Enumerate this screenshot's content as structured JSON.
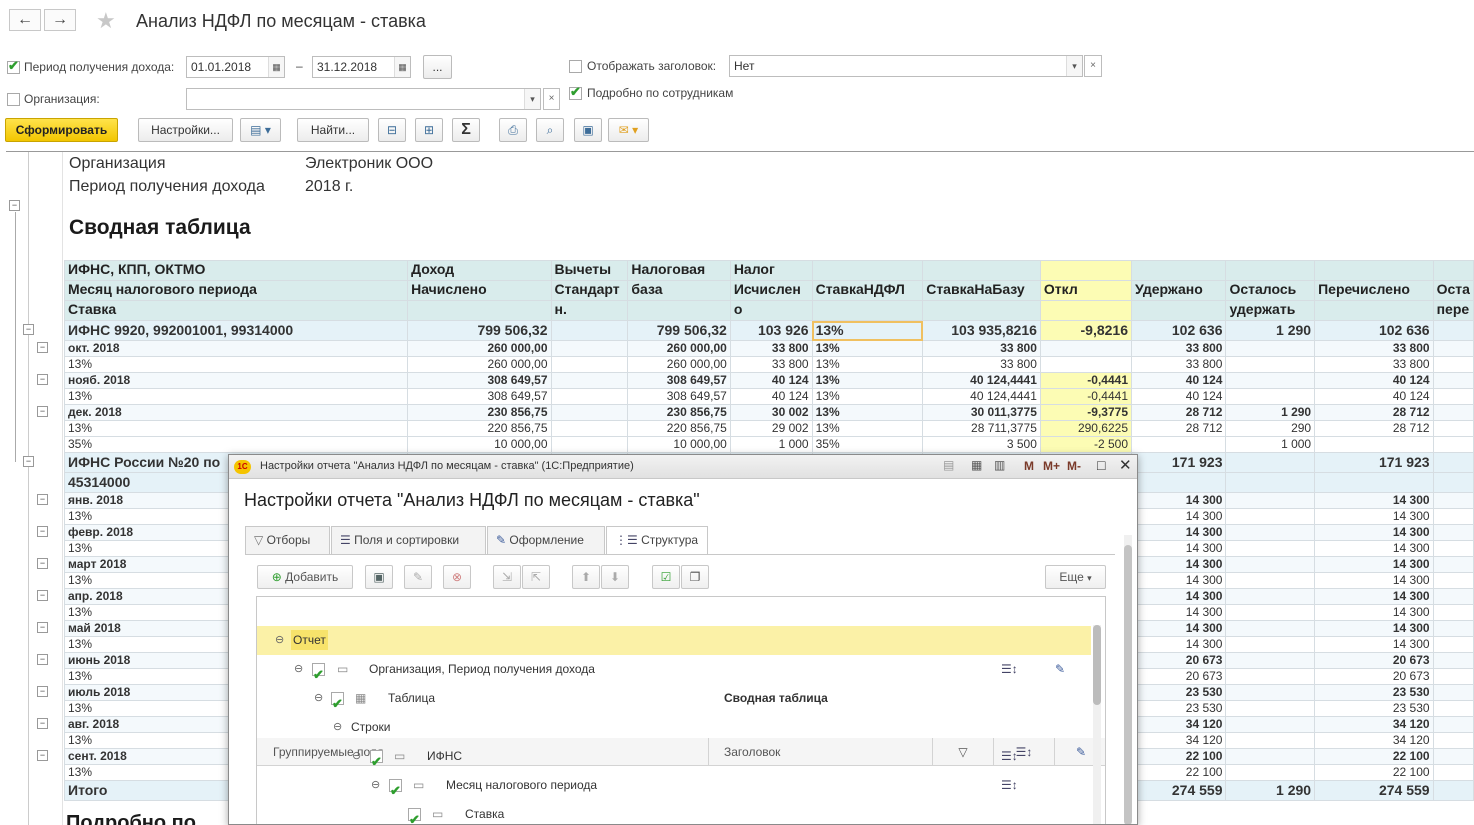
{
  "window": {
    "title": "Анализ НДФЛ по месяцам - ставка",
    "back": "←",
    "forward": "→",
    "star": "★"
  },
  "filters": {
    "period_label": "Период получения дохода:",
    "date_from": "01.01.2018",
    "dash": "–",
    "date_to": "31.12.2018",
    "dots": "...",
    "org_label": "Организация:",
    "org_value": "",
    "show_header_label": "Отображать заголовок:",
    "show_header_value": "Нет",
    "detail_label": "Подробно по сотрудникам"
  },
  "toolbar": {
    "generate": "Сформировать",
    "settings": "Настройки...",
    "find": "Найти...",
    "sum": "Σ"
  },
  "report": {
    "org_label": "Организация",
    "org_value": "Электроник ООО",
    "period_label": "Период получения дохода",
    "period_value": "2018 г.",
    "table_title": "Сводная таблица",
    "headers": [
      [
        "ИФНС, КПП, ОКТМО",
        "Доход",
        "Вычеты",
        "Налоговая",
        "Налог",
        "",
        "",
        "",
        "",
        "",
        "",
        ""
      ],
      [
        "Месяц налогового периода",
        "Начислено",
        "Стандарт",
        "база",
        "Исчислен",
        "СтавкаНДФЛ",
        "СтавкаНаБазу",
        "Откл",
        "Удержано",
        "Осталось",
        "Перечислено",
        "Оста"
      ],
      [
        "Ставка",
        "",
        "н.",
        "",
        "о",
        "",
        "",
        "",
        "",
        "удержать",
        "",
        "пере"
      ]
    ],
    "rows": [
      {
        "lvl": 1,
        "c": [
          "ИФНС 9920, 992001001, 99314000",
          "799 506,32",
          "",
          "799 506,32",
          "103 926",
          "13%",
          "103 935,8216",
          "-9,8216",
          "102 636",
          "1 290",
          "102 636",
          ""
        ]
      },
      {
        "lvl": 2,
        "c": [
          "окт. 2018",
          "260 000,00",
          "",
          "260 000,00",
          "33 800",
          "13%",
          "33 800",
          "",
          "33 800",
          "",
          "33 800",
          ""
        ]
      },
      {
        "lvl": 3,
        "c": [
          "13%",
          "260 000,00",
          "",
          "260 000,00",
          "33 800",
          "13%",
          "33 800",
          "",
          "33 800",
          "",
          "33 800",
          ""
        ]
      },
      {
        "lvl": 2,
        "c": [
          "нояб. 2018",
          "308 649,57",
          "",
          "308 649,57",
          "40 124",
          "13%",
          "40 124,4441",
          "-0,4441",
          "40 124",
          "",
          "40 124",
          ""
        ]
      },
      {
        "lvl": 3,
        "c": [
          "13%",
          "308 649,57",
          "",
          "308 649,57",
          "40 124",
          "13%",
          "40 124,4441",
          "-0,4441",
          "40 124",
          "",
          "40 124",
          ""
        ]
      },
      {
        "lvl": 2,
        "c": [
          "дек. 2018",
          "230 856,75",
          "",
          "230 856,75",
          "30 002",
          "13%",
          "30 011,3775",
          "-9,3775",
          "28 712",
          "1 290",
          "28 712",
          ""
        ]
      },
      {
        "lvl": 3,
        "c": [
          "13%",
          "220 856,75",
          "",
          "220 856,75",
          "29 002",
          "13%",
          "28 711,3775",
          "290,6225",
          "28 712",
          "290",
          "28 712",
          ""
        ]
      },
      {
        "lvl": 3,
        "c": [
          "35%",
          "10 000,00",
          "",
          "10 000,00",
          "1 000",
          "35%",
          "3 500",
          "-2 500",
          "",
          "1 000",
          "",
          ""
        ]
      },
      {
        "lvl": 1,
        "c": [
          "ИФНС России №20 по",
          "",
          "",
          "",
          "",
          "",
          "",
          "",
          "171 923",
          "",
          "171 923",
          ""
        ]
      },
      {
        "lvl": 1,
        "c": [
          "45314000",
          "",
          "",
          "",
          "",
          "",
          "",
          "",
          "",
          "",
          "",
          ""
        ]
      },
      {
        "lvl": 2,
        "c": [
          "янв. 2018",
          "",
          "",
          "",
          "",
          "",
          "",
          "",
          "14 300",
          "",
          "14 300",
          ""
        ]
      },
      {
        "lvl": 3,
        "c": [
          "13%",
          "",
          "",
          "",
          "",
          "",
          "",
          "",
          "14 300",
          "",
          "14 300",
          ""
        ]
      },
      {
        "lvl": 2,
        "c": [
          "февр. 2018",
          "",
          "",
          "",
          "",
          "",
          "",
          "",
          "14 300",
          "",
          "14 300",
          ""
        ]
      },
      {
        "lvl": 3,
        "c": [
          "13%",
          "",
          "",
          "",
          "",
          "",
          "",
          "",
          "14 300",
          "",
          "14 300",
          ""
        ]
      },
      {
        "lvl": 2,
        "c": [
          "март 2018",
          "",
          "",
          "",
          "",
          "",
          "",
          "",
          "14 300",
          "",
          "14 300",
          ""
        ]
      },
      {
        "lvl": 3,
        "c": [
          "13%",
          "",
          "",
          "",
          "",
          "",
          "",
          "",
          "14 300",
          "",
          "14 300",
          ""
        ]
      },
      {
        "lvl": 2,
        "c": [
          "апр. 2018",
          "",
          "",
          "",
          "",
          "",
          "",
          "",
          "14 300",
          "",
          "14 300",
          ""
        ]
      },
      {
        "lvl": 3,
        "c": [
          "13%",
          "",
          "",
          "",
          "",
          "",
          "",
          "",
          "14 300",
          "",
          "14 300",
          ""
        ]
      },
      {
        "lvl": 2,
        "c": [
          "май 2018",
          "",
          "",
          "",
          "",
          "",
          "",
          "",
          "14 300",
          "",
          "14 300",
          ""
        ]
      },
      {
        "lvl": 3,
        "c": [
          "13%",
          "",
          "",
          "",
          "",
          "",
          "",
          "",
          "14 300",
          "",
          "14 300",
          ""
        ]
      },
      {
        "lvl": 2,
        "c": [
          "июнь 2018",
          "",
          "",
          "",
          "",
          "",
          "",
          "",
          "20 673",
          "",
          "20 673",
          ""
        ]
      },
      {
        "lvl": 3,
        "c": [
          "13%",
          "",
          "",
          "",
          "",
          "",
          "",
          "",
          "20 673",
          "",
          "20 673",
          ""
        ]
      },
      {
        "lvl": 2,
        "c": [
          "июль 2018",
          "",
          "",
          "",
          "",
          "",
          "",
          "",
          "23 530",
          "",
          "23 530",
          ""
        ]
      },
      {
        "lvl": 3,
        "c": [
          "13%",
          "",
          "",
          "",
          "",
          "",
          "",
          "",
          "23 530",
          "",
          "23 530",
          ""
        ]
      },
      {
        "lvl": 2,
        "c": [
          "авг. 2018",
          "",
          "",
          "",
          "",
          "",
          "",
          "",
          "34 120",
          "",
          "34 120",
          ""
        ]
      },
      {
        "lvl": 3,
        "c": [
          "13%",
          "",
          "",
          "",
          "",
          "",
          "",
          "",
          "34 120",
          "",
          "34 120",
          ""
        ]
      },
      {
        "lvl": 2,
        "c": [
          "сент. 2018",
          "",
          "",
          "",
          "",
          "",
          "",
          "",
          "22 100",
          "",
          "22 100",
          ""
        ]
      },
      {
        "lvl": 3,
        "c": [
          "13%",
          "",
          "",
          "",
          "",
          "",
          "",
          "",
          "22 100",
          "",
          "22 100",
          ""
        ]
      },
      {
        "lvl": 1,
        "c": [
          "Итого",
          "",
          "",
          "",
          "",
          "",
          "",
          "",
          "274 559",
          "1 290",
          "274 559",
          ""
        ]
      }
    ],
    "bottom_text": "Подробно по"
  },
  "dialog": {
    "window_title": "Настройки отчета \"Анализ НДФЛ по месяцам - ставка\" (1С:Предприятие)",
    "app_icon": "1С",
    "heading": "Настройки отчета \"Анализ НДФЛ по месяцам - ставка\"",
    "tabs": [
      "Отборы",
      "Поля и сортировки",
      "Оформление",
      "Структура"
    ],
    "add": "Добавить",
    "more": "Еще",
    "col_fields": "Группируемые поля",
    "col_header": "Заголовок",
    "tree": [
      {
        "label": "Отчет",
        "header": ""
      },
      {
        "label": "Организация, Период получения дохода",
        "header": ""
      },
      {
        "label": "Таблица",
        "header": "Сводная таблица"
      },
      {
        "label": "Строки",
        "header": ""
      },
      {
        "label": "ИФНС",
        "header": ""
      },
      {
        "label": "Месяц налогового периода",
        "header": ""
      },
      {
        "label": "Ставка",
        "header": ""
      }
    ],
    "tb_icons": {
      "m": "M",
      "mplus": "M+",
      "mminus": "M-"
    }
  }
}
